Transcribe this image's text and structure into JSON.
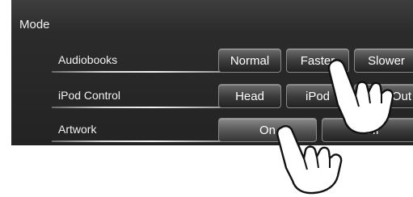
{
  "header": {
    "title": "Mode"
  },
  "settings": [
    {
      "label": "Audiobooks",
      "options": [
        "Normal",
        "Faster",
        "Slower"
      ]
    },
    {
      "label": "iPod Control",
      "options": [
        "Head",
        "iPod",
        "Out"
      ]
    },
    {
      "label": "Artwork",
      "options": [
        "On",
        "Off"
      ]
    }
  ],
  "icons": {
    "pointer": "hand-pointer-icon"
  }
}
